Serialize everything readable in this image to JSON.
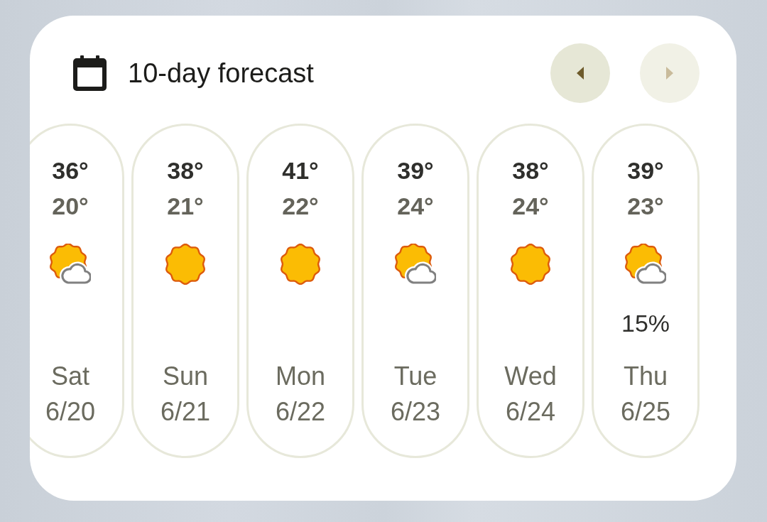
{
  "header": {
    "title": "10-day forecast"
  },
  "nav": [
    {
      "kind": "previous",
      "disabled": false
    },
    {
      "kind": "next",
      "disabled": true
    }
  ],
  "days": [
    {
      "high": "36°",
      "low": "20°",
      "kind": "partly-cloudy",
      "day": "Sat",
      "date": "6/20"
    },
    {
      "high": "38°",
      "low": "21°",
      "kind": "sunny",
      "day": "Sun",
      "date": "6/21"
    },
    {
      "high": "41°",
      "low": "22°",
      "kind": "sunny",
      "day": "Mon",
      "date": "6/22"
    },
    {
      "high": "39°",
      "low": "24°",
      "kind": "partly-cloudy",
      "day": "Tue",
      "date": "6/23"
    },
    {
      "high": "38°",
      "low": "24°",
      "kind": "sunny",
      "day": "Wed",
      "date": "6/24"
    },
    {
      "high": "39°",
      "low": "23°",
      "kind": "partly-cloudy",
      "precip": "15%",
      "day": "Thu",
      "date": "6/25"
    }
  ]
}
